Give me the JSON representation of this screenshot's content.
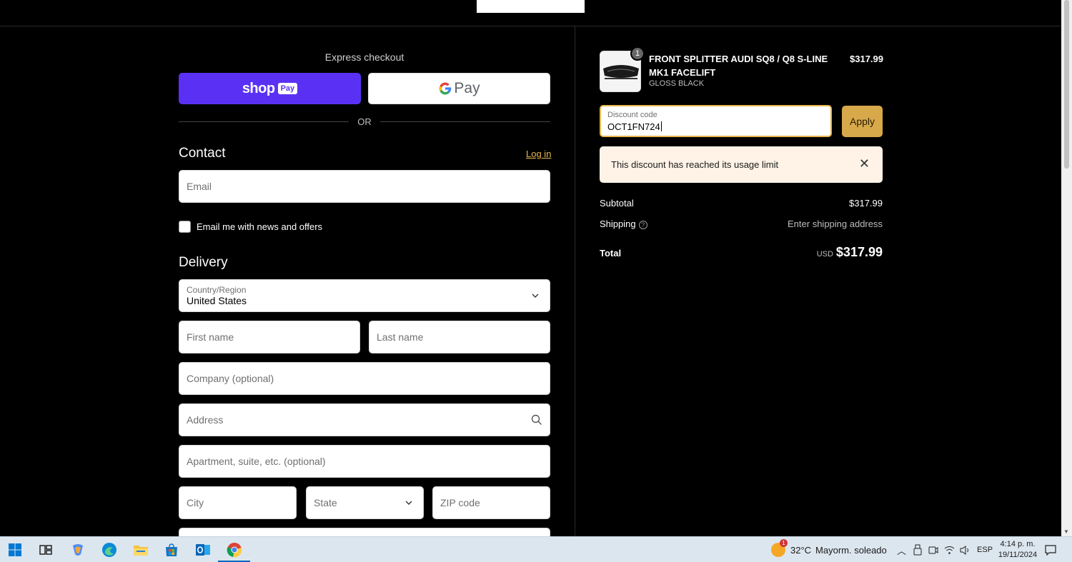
{
  "left": {
    "express_title": "Express checkout",
    "shoppay_word": "shop",
    "shoppay_badge": "Pay",
    "gpay_label": "Pay",
    "or_label": "OR",
    "contact_title": "Contact",
    "login_link": "Log in",
    "email_placeholder": "Email",
    "newsletter_label": "Email me with news and offers",
    "delivery_title": "Delivery",
    "country_label": "Country/Region",
    "country_value": "United States",
    "first_name_placeholder": "First name",
    "last_name_placeholder": "Last name",
    "company_placeholder": "Company (optional)",
    "address_placeholder": "Address",
    "apartment_placeholder": "Apartment, suite, etc. (optional)",
    "city_placeholder": "City",
    "state_placeholder": "State",
    "zip_placeholder": "ZIP code"
  },
  "summary": {
    "quantity": "1",
    "product_name": "FRONT SPLITTER AUDI SQ8 / Q8 S-LINE MK1 FACELIFT",
    "variant": "GLOSS BLACK",
    "price": "$317.99",
    "discount_label": "Discount code",
    "discount_value": "OCT1FN724",
    "apply_label": "Apply",
    "alert_message": "This discount has reached its usage limit",
    "subtotal_label": "Subtotal",
    "subtotal_value": "$317.99",
    "shipping_label": "Shipping",
    "shipping_value": "Enter shipping address",
    "total_label": "Total",
    "total_currency": "USD",
    "total_value": "$317.99"
  },
  "taskbar": {
    "weather_temp": "32°C",
    "weather_desc": "Mayorm. soleado",
    "weather_badge": "1",
    "language": "ESP",
    "time": "4:14 p. m.",
    "date": "19/11/2024",
    "apps": [
      "start-icon",
      "task-view-icon",
      "copilot-icon",
      "edge-icon",
      "file-explorer-icon",
      "store-icon",
      "outlook-icon",
      "chrome-icon"
    ]
  },
  "colors": {
    "background": "#000000",
    "shoppay": "#5a31f4",
    "accent": "#d8a94b",
    "alert_bg": "#fef3e6"
  }
}
